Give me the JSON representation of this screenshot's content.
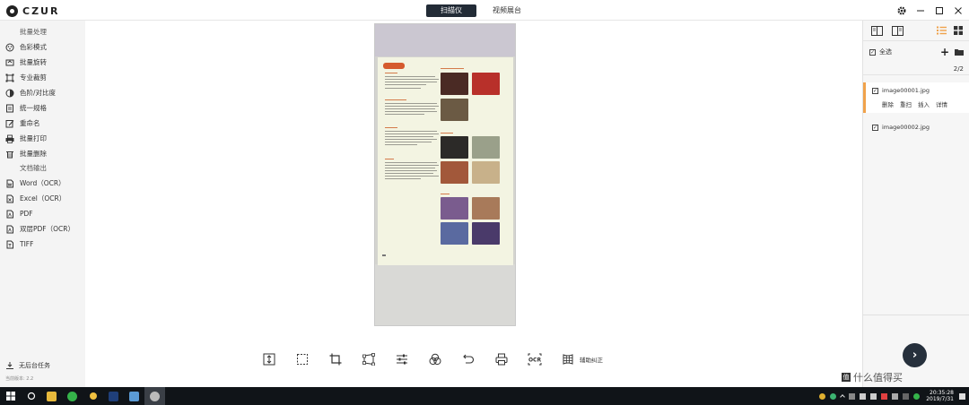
{
  "app": {
    "logo_text": "CZUR",
    "mode_tabs": [
      "扫描仪",
      "视频展台"
    ]
  },
  "window_icons": [
    "gear-icon",
    "minimize-icon",
    "maximize-icon",
    "close-icon"
  ],
  "sidebar": {
    "batch_title": "批量处理",
    "batch_items": [
      {
        "label": "色彩模式",
        "icon": "palette-icon"
      },
      {
        "label": "批量旋转",
        "icon": "rotate-icon"
      },
      {
        "label": "专业裁剪",
        "icon": "crop-icon"
      },
      {
        "label": "色阶/对比度",
        "icon": "contrast-icon"
      },
      {
        "label": "统一规格",
        "icon": "document-icon"
      },
      {
        "label": "重命名",
        "icon": "rename-icon"
      },
      {
        "label": "批量打印",
        "icon": "printer-icon"
      },
      {
        "label": "批量删除",
        "icon": "trash-icon"
      }
    ],
    "export_title": "文档输出",
    "export_items": [
      {
        "label": "Word（OCR）",
        "icon": "word-icon"
      },
      {
        "label": "Excel（OCR）",
        "icon": "excel-icon"
      },
      {
        "label": "PDF",
        "icon": "pdf-icon"
      },
      {
        "label": "双层PDF（OCR）",
        "icon": "pdf-icon"
      },
      {
        "label": "TIFF",
        "icon": "tiff-icon"
      }
    ],
    "bottom_task": "无后台任务",
    "version": "当前版本:  2.2"
  },
  "toolbar": {
    "tools": [
      "fit-height-icon",
      "select-icon",
      "crop-icon",
      "perspective-icon",
      "adjust-icon",
      "color-icon",
      "undo-icon",
      "print-icon",
      "ocr-icon",
      "curve-correct-icon"
    ],
    "ocr_label": "OCR",
    "correct_label": "辅助纠正"
  },
  "right_panel": {
    "select_all": "全选",
    "count": "2/2",
    "images": [
      {
        "name": "image00001.jpg",
        "selected": true,
        "actions": [
          "删除",
          "重扫",
          "插入",
          "详情"
        ]
      },
      {
        "name": "image00002.jpg",
        "selected": false
      }
    ],
    "next_icon": "arrow-right-icon"
  },
  "watermark": {
    "badge": "值",
    "text": "什么值得买"
  },
  "taskbar": {
    "time": "20:35:28",
    "date": "2019/7/31"
  },
  "colors": {
    "active_tab": "#222b36",
    "selected_accent": "#f0a24b",
    "next_button": "#26303c",
    "taskbar": "#101418"
  }
}
